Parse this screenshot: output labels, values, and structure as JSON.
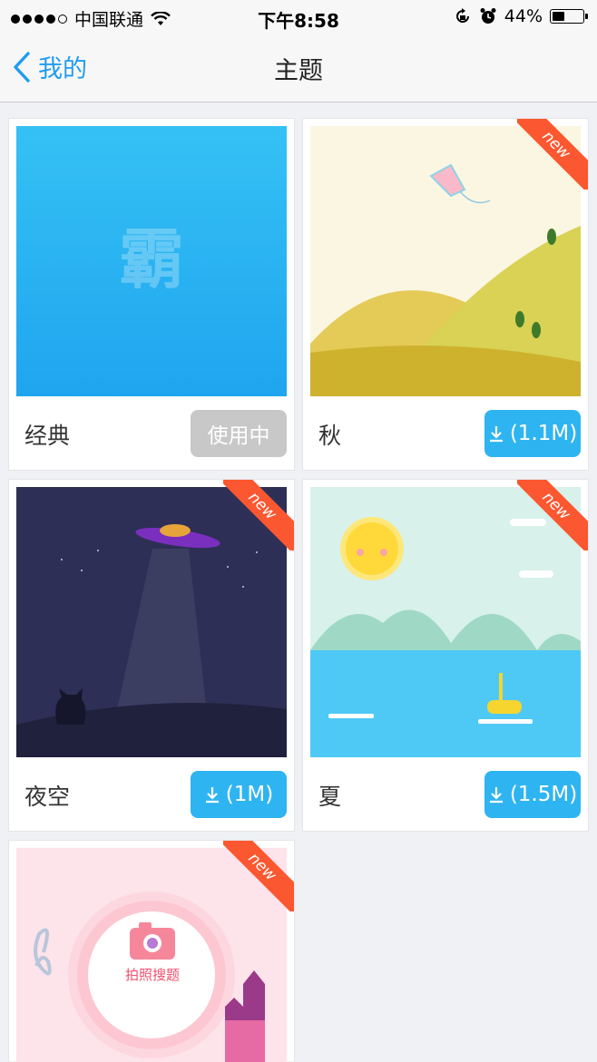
{
  "status_bar": {
    "carrier": "中国联通",
    "time": "下午8:58",
    "battery": "44%",
    "battery_level": 0.44
  },
  "nav": {
    "back_label": "我的",
    "title": "主题"
  },
  "themes": [
    {
      "name": "经典",
      "button": "使用中",
      "state": "using",
      "thumb_text": "霸"
    },
    {
      "name": "秋",
      "button": "(1.1M)",
      "state": "download",
      "badge": "new"
    },
    {
      "name": "夜空",
      "button": "(1M)",
      "state": "download",
      "badge": "new"
    },
    {
      "name": "夏",
      "button": "(1.5M)",
      "state": "download",
      "badge": "new"
    },
    {
      "badge": "new",
      "thumb_text": "拍照搜题"
    }
  ],
  "colors": {
    "accent": "#1f9cf0",
    "download_button": "#2fb4f2",
    "using_button": "#c8c8c8",
    "new_badge": "#fb5730"
  }
}
